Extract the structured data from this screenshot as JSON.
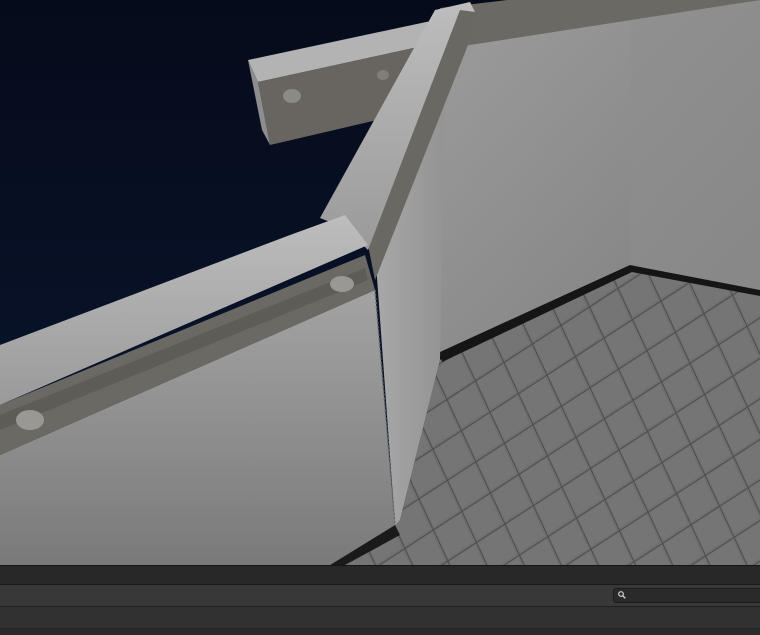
{
  "scene": {
    "sky_color": "#060d1f",
    "wall_color": "#9a9a9a",
    "rail_color": "#6e6c67",
    "floor_color": "#6c6c6c"
  },
  "panel": {
    "search": {
      "placeholder": "",
      "value": "",
      "icon": "search-icon"
    }
  }
}
